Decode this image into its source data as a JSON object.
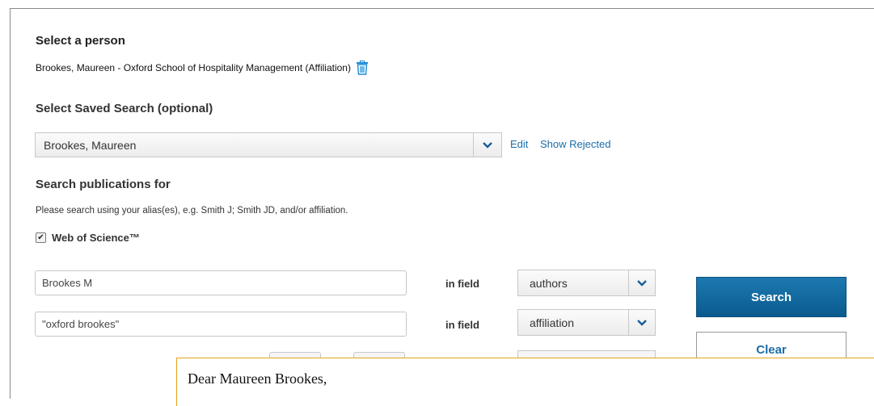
{
  "select_person": {
    "heading": "Select a person",
    "selected": "Brookes, Maureen - Oxford School of Hospitality Management (Affiliation)"
  },
  "saved_search": {
    "heading": "Select Saved Search (optional)",
    "selected": "Brookes, Maureen",
    "edit_label": "Edit",
    "show_rejected_label": "Show Rejected"
  },
  "search_publications": {
    "heading": "Search publications for",
    "hint": "Please search using your alias(es), e.g. Smith J; Smith JD, and/or affiliation.",
    "database_label": "Web of Science™",
    "database_checked": true,
    "in_field_label": "in field",
    "rows": [
      {
        "value": "Brookes M",
        "field": "authors"
      },
      {
        "value": "\"oxford brookes\"",
        "field": "affiliation"
      }
    ]
  },
  "buttons": {
    "search_label": "Search",
    "clear_label": "Clear"
  },
  "popup": {
    "greeting": "Dear Maureen Brookes,"
  },
  "colors": {
    "link": "#1a6ea8",
    "primary_button": "#0a5b8e",
    "popup_border": "#e4a21a",
    "trash_icon": "#1a8bd6"
  },
  "icons": {
    "delete": "trash-icon",
    "dropdown": "chevron-down-icon",
    "check": "checkmark-icon"
  }
}
